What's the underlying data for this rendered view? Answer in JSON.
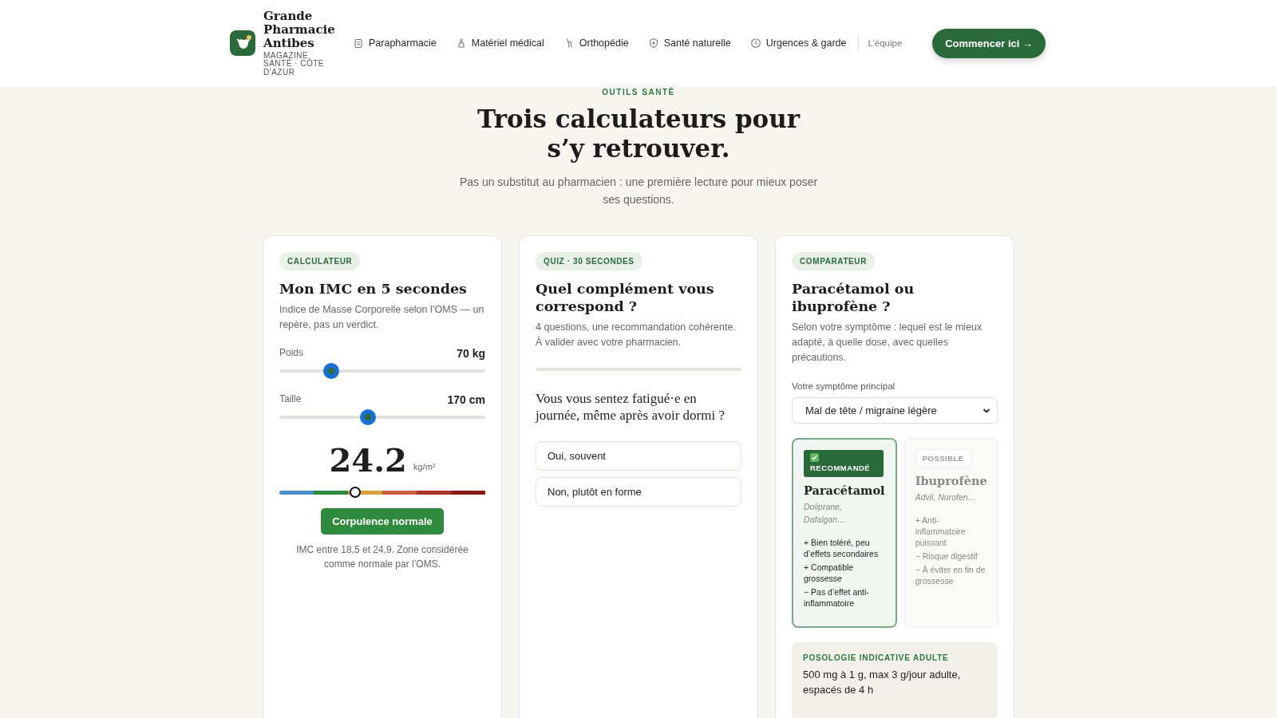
{
  "header": {
    "brand": {
      "name": "Grande Pharmacie Antibes",
      "tagline": "MAGAZINE SANTÉ · CÔTE D'AZUR"
    },
    "nav": [
      {
        "label": "Parapharmacie",
        "kind": "icon"
      },
      {
        "label": "Matériel médical",
        "kind": "icon"
      },
      {
        "label": "Orthopédie",
        "kind": "icon"
      },
      {
        "label": "Santé naturelle",
        "kind": "icon"
      },
      {
        "label": "Urgences & garde",
        "kind": "icon"
      },
      {
        "label": "L’équipe",
        "kind": "plain"
      }
    ],
    "cta": {
      "label": "Commencer ici",
      "arrow": "→"
    }
  },
  "hero": {
    "eyebrow": "OUTILS SANTÉ",
    "title": "Trois calculateurs pour s’y retrouver.",
    "subtitle": "Pas un substitut au pharmacien : une première lecture pour mieux poser ses questions."
  },
  "bmi": {
    "tag": "CALCULATEUR",
    "title": "Mon IMC en 5 secondes",
    "description": "Indice de Masse Corporelle selon l’OMS — un repère, pas un verdict.",
    "sliders": [
      {
        "label": "Poids",
        "reading": "70 kg",
        "level": 0.25
      },
      {
        "label": "Taille",
        "reading": "170 cm",
        "level": 0.43
      }
    ],
    "value": "24.2",
    "unit": "kg/m²",
    "scale": [
      {
        "color": "#4a8fc9"
      },
      {
        "color": "#2e8b3e"
      },
      {
        "color": "#d9a03a"
      },
      {
        "color": "#c75f3e"
      },
      {
        "color": "#a8372a"
      },
      {
        "color": "#861c14"
      }
    ],
    "marker": {
      "level": 0.37
    },
    "verdict": "Corpulence normale",
    "note": "IMC entre 18,5 et 24,9. Zone considérée comme normale par l’OMS."
  },
  "quiz": {
    "tag": "QUIZ · 30 SECONDES",
    "title": "Quel complément vous correspond ?",
    "description": "4 questions, une recommandation cohérente. À valider avec votre pharmacien.",
    "question": "Vous vous sentez fatigué·e en journée, même après avoir dormi ?",
    "answers": [
      "Oui, souvent",
      "Non, plutôt en forme"
    ]
  },
  "comparator": {
    "tag": "COMPARATEUR",
    "title": "Paracétamol ou ibuprofène ?",
    "description": "Selon votre symptôme : lequel est le mieux adapté, à quelle dose, avec quelles précautions.",
    "field_label": "Votre symptôme principal",
    "symptom": "Mal de tête / migraine légère",
    "options": [
      {
        "badge": "RECOMMANDÉ",
        "name": "Paracétamol",
        "brands": "Doliprane, Dafalgan…",
        "selected": true,
        "points": [
          "+ Bien toléré, peu d’effets secondaires",
          "+ Compatible grossesse",
          "− Pas d’effet anti-inflammatoire"
        ]
      },
      {
        "badge": "POSSIBLE",
        "name": "Ibuprofène",
        "brands": "Advil, Nurofen…",
        "selected": false,
        "points": [
          "+ Anti-inflammatoire puissant",
          "− Risque digestif",
          "− À éviter en fin de grossesse"
        ]
      }
    ],
    "dosage": {
      "label": "POSOLOGIE INDICATIVE ADULTE",
      "text": "500 mg à 1 g, max 3 g/jour adulte, espacés de 4 h"
    }
  }
}
